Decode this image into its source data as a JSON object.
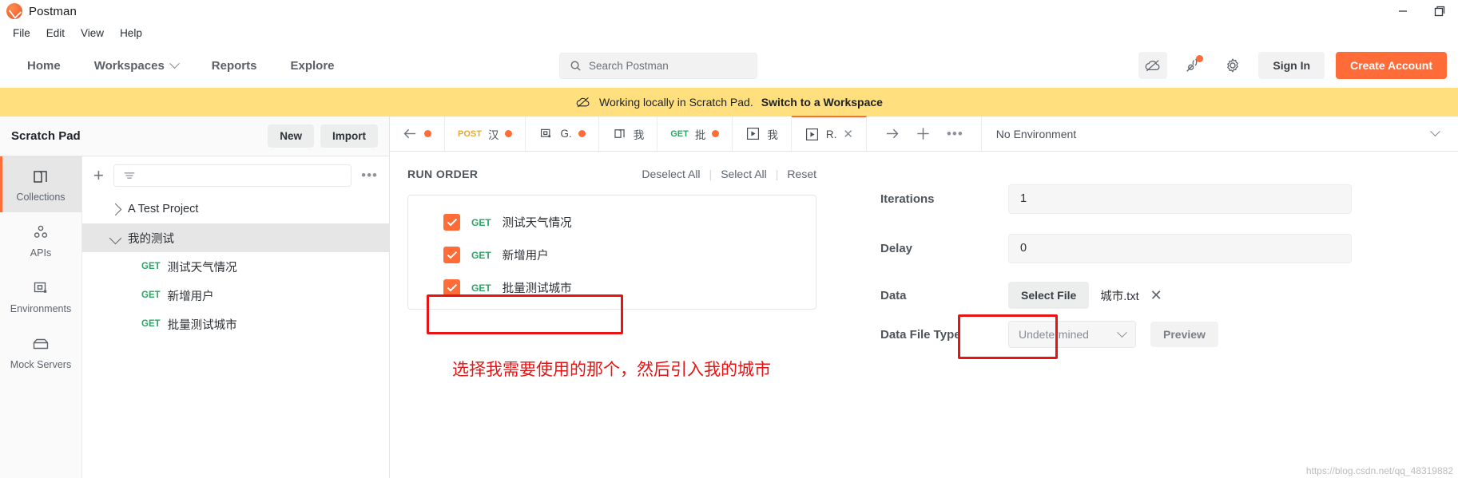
{
  "window": {
    "app_title": "Postman",
    "logo_icon": "postman-logo-icon",
    "minimize_icon": "minimize-icon",
    "maximize_icon": "maximize-icon"
  },
  "menubar": {
    "items": [
      {
        "label": "File"
      },
      {
        "label": "Edit"
      },
      {
        "label": "View"
      },
      {
        "label": "Help"
      }
    ]
  },
  "header": {
    "nav": [
      {
        "label": "Home",
        "has_caret": false
      },
      {
        "label": "Workspaces",
        "has_caret": true
      },
      {
        "label": "Reports",
        "has_caret": false
      },
      {
        "label": "Explore",
        "has_caret": false
      }
    ],
    "search": {
      "placeholder": "Search Postman",
      "icon": "search-icon"
    },
    "actions": {
      "cloud_icon": "cloud-offline-icon",
      "notifications_icon": "satellite-notifications-icon",
      "settings_icon": "gear-icon",
      "sign_in_label": "Sign In",
      "create_account_label": "Create Account"
    }
  },
  "banner": {
    "icon": "cloud-offline-icon",
    "text": "Working locally in Scratch Pad.",
    "link": "Switch to a Workspace",
    "background": "#ffdf7e"
  },
  "sidebar": {
    "title": "Scratch Pad",
    "new_label": "New",
    "import_label": "Import",
    "rail": [
      {
        "label": "Collections",
        "icon": "collections-icon",
        "active": true
      },
      {
        "label": "APIs",
        "icon": "apis-icon",
        "active": false
      },
      {
        "label": "Environments",
        "icon": "environments-icon",
        "active": false
      },
      {
        "label": "Mock Servers",
        "icon": "mock-servers-icon",
        "active": false
      }
    ],
    "toolbar": {
      "add_icon": "plus-icon",
      "filter_icon": "filter-icon",
      "more_icon": "more-options-icon"
    },
    "tree": [
      {
        "label": "A Test Project",
        "expanded": false,
        "selected": false
      },
      {
        "label": "我的测试",
        "expanded": true,
        "selected": true
      }
    ],
    "requests": [
      {
        "method": "GET",
        "name": "测试天气情况"
      },
      {
        "method": "GET",
        "name": "新增用户"
      },
      {
        "method": "GET",
        "name": "批量测试城市"
      }
    ]
  },
  "tabbar": {
    "tabs": [
      {
        "icon": "back-arrow-icon",
        "label": "",
        "unsaved": true,
        "active": false
      },
      {
        "method": "POST",
        "label": "汉",
        "unsaved": true,
        "active": false
      },
      {
        "icon": "environment-icon",
        "label": "G.",
        "unsaved": true,
        "active": false
      },
      {
        "icon": "document-icon",
        "label": "我",
        "unsaved": false,
        "active": false
      },
      {
        "method": "GET",
        "label": "批",
        "unsaved": true,
        "active": false
      },
      {
        "icon": "runner-icon",
        "label": "我",
        "unsaved": false,
        "active": false
      },
      {
        "icon": "runner-icon",
        "label": "R.",
        "unsaved": false,
        "active": true,
        "closable": true
      }
    ],
    "actions": {
      "forward_icon": "forward-arrow-icon",
      "new_tab_icon": "plus-icon",
      "more_icon": "more-options-icon"
    },
    "environment": {
      "selected": "No Environment",
      "caret_icon": "chevron-down-icon"
    }
  },
  "runner": {
    "run_order_title": "RUN ORDER",
    "deselect_all": "Deselect All",
    "select_all": "Select All",
    "reset": "Reset",
    "items": [
      {
        "method": "GET",
        "name": "测试天气情况",
        "checked": true,
        "highlighted": false
      },
      {
        "method": "GET",
        "name": "新增用户",
        "checked": true,
        "highlighted": false
      },
      {
        "method": "GET",
        "name": "批量测试城市",
        "checked": true,
        "highlighted": true
      }
    ],
    "annotation": "选择我需要使用的那个，然后引入我的城市",
    "annotation_color": "#e81313",
    "settings": {
      "iterations_label": "Iterations",
      "iterations_value": "1",
      "delay_label": "Delay",
      "delay_value": "0",
      "data_label": "Data",
      "select_file_label": "Select File",
      "file_name": "城市.txt",
      "remove_file_icon": "close-icon",
      "data_file_type_label": "Data File Type",
      "data_file_type_value": "Undetermined",
      "preview_label": "Preview"
    }
  },
  "watermark": "https://blog.csdn.net/qq_48319882"
}
